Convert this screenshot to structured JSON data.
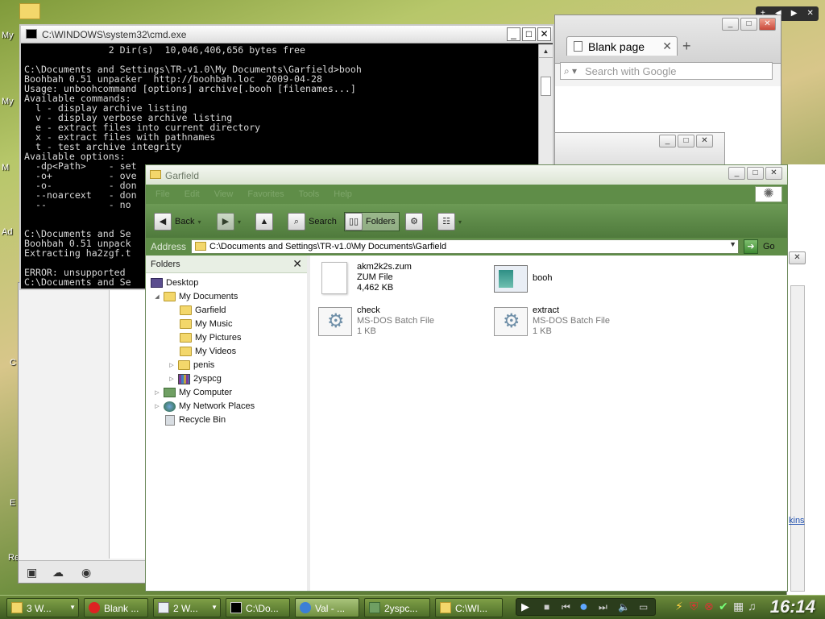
{
  "desktop": {
    "icons": [
      "My",
      "My",
      "M",
      "Ad",
      "C",
      "E",
      "Re"
    ]
  },
  "overlay_nav": {
    "plus": "+",
    "prev": "◀",
    "next": "▶",
    "close": "✕"
  },
  "browser": {
    "tab_title": "Blank page",
    "search_placeholder": "Search with Google"
  },
  "cmd": {
    "title": "C:\\WINDOWS\\system32\\cmd.exe",
    "lines": [
      "               2 Dir(s)  10,046,406,656 bytes free",
      "",
      "C:\\Documents and Settings\\TR-v1.0\\My Documents\\Garfield>booh",
      "Boohbah 0.51 unpacker  http://boohbah.loc  2009-04-28",
      "Usage: unboohcommand [options] archive[.booh [filenames...]",
      "Available commands:",
      "  l - display archive listing",
      "  v - display verbose archive listing",
      "  e - extract files into current directory",
      "  x - extract files with pathnames",
      "  t - test archive integrity",
      "Available options:",
      "  -dp<Path>    - set",
      "  -o+          - ove",
      "  -o-          - don",
      "  --noarcext   - don",
      "  --           - no ",
      "",
      "",
      "C:\\Documents and Se",
      "Boohbah 0.51 unpack",
      "Extracting ha2zgf.t",
      "",
      "ERROR: unsupported ",
      "C:\\Documents and Se"
    ]
  },
  "explorer": {
    "title": "Garfield",
    "menu": [
      "File",
      "Edit",
      "View",
      "Favorites",
      "Tools",
      "Help"
    ],
    "toolbar": {
      "back": "Back",
      "search": "Search",
      "folders": "Folders"
    },
    "address_label": "Address",
    "address_value": "C:\\Documents and Settings\\TR-v1.0\\My Documents\\Garfield",
    "go_label": "Go",
    "folders_pane_title": "Folders",
    "tree": [
      {
        "label": "Desktop"
      },
      {
        "label": "My Documents"
      },
      {
        "label": "Garfield"
      },
      {
        "label": "My Music"
      },
      {
        "label": "My Pictures"
      },
      {
        "label": "My Videos"
      },
      {
        "label": "penis"
      },
      {
        "label": "2yspcg"
      },
      {
        "label": "My Computer"
      },
      {
        "label": "My Network Places"
      },
      {
        "label": "Recycle Bin"
      }
    ],
    "files": [
      {
        "name": "akm2k2s.zum",
        "type": "ZUM File",
        "size": "4,462 KB"
      },
      {
        "name": "booh",
        "type": "",
        "size": ""
      },
      {
        "name": "check",
        "type": "MS-DOS Batch File",
        "size": "1 KB"
      },
      {
        "name": "extract",
        "type": "MS-DOS Batch File",
        "size": "1 KB"
      }
    ]
  },
  "right_window": {
    "link": "kins"
  },
  "taskbar": {
    "tasks": [
      "3 W...",
      "Blank ...",
      "2 W...",
      "C:\\Do...",
      "Val - ...",
      "2yspc...",
      "C:\\WI..."
    ],
    "clock": "16:14"
  },
  "colors": {
    "explorer_theme": "#5f8d48",
    "taskbar": "#4e6f2a",
    "cmd_bg": "#000000",
    "cmd_text": "#d8d8d8"
  }
}
